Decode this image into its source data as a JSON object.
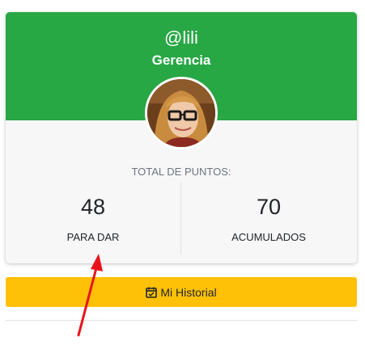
{
  "profile": {
    "username": "@lili",
    "role": "Gerencia",
    "avatar_icon": "user-photo"
  },
  "points": {
    "total_label": "TOTAL DE PUNTOS:",
    "to_give_value": "48",
    "to_give_label": "PARA DAR",
    "accumulated_value": "70",
    "accumulated_label": "ACUMULADOS"
  },
  "actions": {
    "history_label": "Mi Historial",
    "history_icon": "calendar-check-icon"
  },
  "colors": {
    "header_green": "#28a745",
    "button_yellow": "#ffc107",
    "annotation_arrow": "#e8141a"
  }
}
